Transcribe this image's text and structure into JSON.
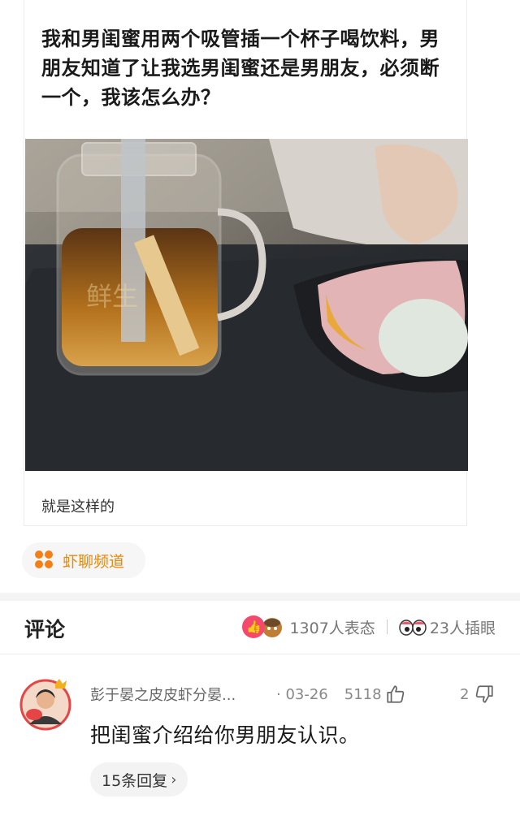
{
  "post": {
    "title": "我和男闺蜜用两个吸管插一个杯子喝饮料，男朋友知道了让我选男闺蜜还是男朋友，必须断一个，我该怎么办？",
    "caption": "就是这样的"
  },
  "channel": {
    "icon": "apps-icon",
    "label": "虾聊频道",
    "color": "#f57f17"
  },
  "comments_header": {
    "title": "评论",
    "reactions_text": "1307人表态",
    "views_text": "23人插眼"
  },
  "comments": [
    {
      "username": "彭于晏之皮皮虾分晏...",
      "date": "· 03-26",
      "likes": "5118",
      "dislikes": "2",
      "text": "把闺蜜介绍给你男朋友认识。",
      "replies_label": "15条回复"
    }
  ],
  "colors": {
    "accent": "#f4486d",
    "channel": "#e8890c"
  }
}
